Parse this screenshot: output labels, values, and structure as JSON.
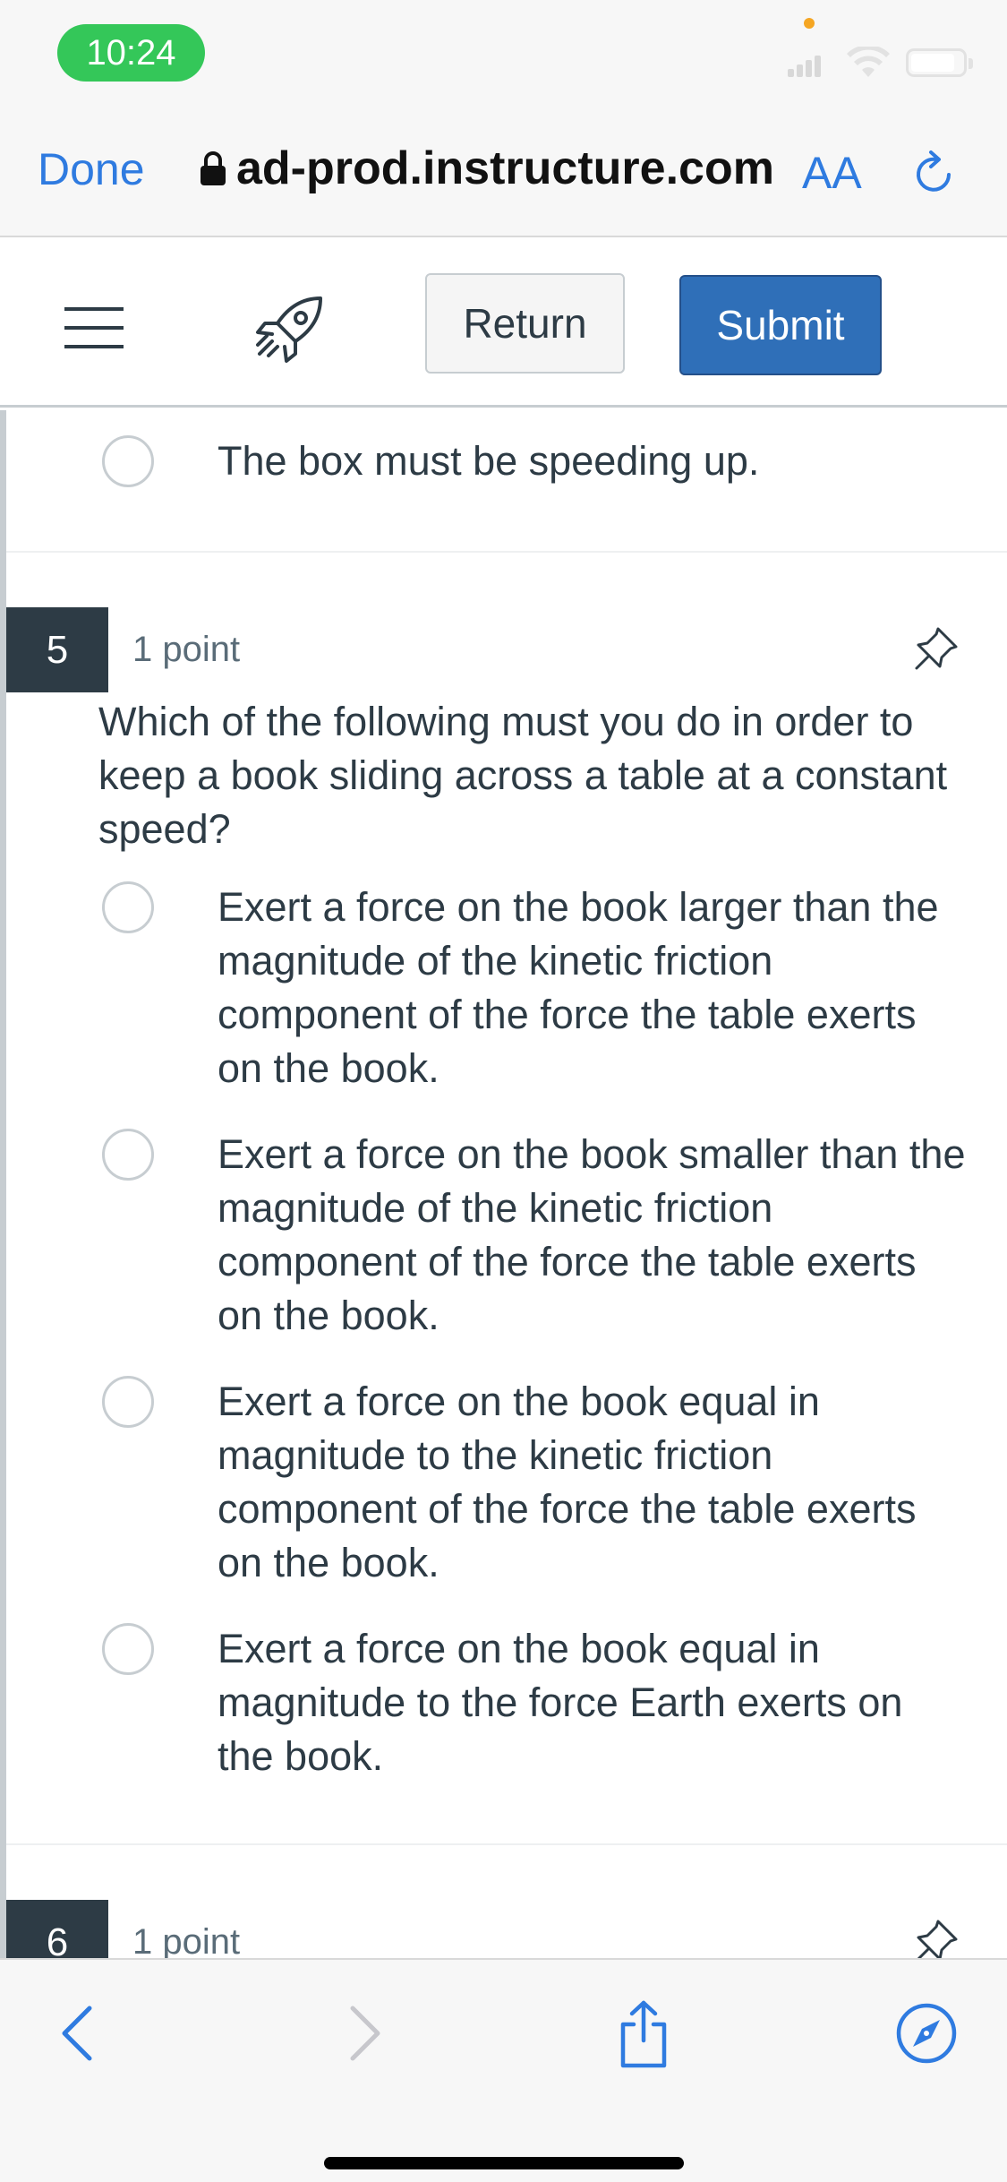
{
  "status_bar": {
    "time": "10:24"
  },
  "browser": {
    "done_label": "Done",
    "url": "ad-prod.instructure.com",
    "aa_label": "AA"
  },
  "header": {
    "return_label": "Return",
    "submit_label": "Submit"
  },
  "prev_answer": {
    "text": "The box must be speeding up."
  },
  "question5": {
    "number": "5",
    "points": "1 point",
    "text": "Which of the following must you do in order to keep a book sliding across a table at a constant speed?",
    "answers": [
      "Exert a force on the book larger than the magnitude of the kinetic friction component of the force the table exerts on the book.",
      "Exert a force on the book smaller than the magnitude of the kinetic friction component of the force the table exerts on the book.",
      "Exert a force on the book equal in magnitude to the kinetic friction component of the force the table exerts on the book.",
      "Exert a force on the book equal in magnitude to the force Earth exerts on the book."
    ]
  },
  "question6": {
    "number": "6",
    "points": "1 point"
  },
  "colors": {
    "accent_blue": "#2f7be0",
    "submit_blue": "#2f6fb8",
    "question_badge": "#2d3b45",
    "time_pill": "#34c759"
  },
  "toolbar_icons": [
    "back-icon",
    "forward-icon",
    "share-icon",
    "compass-icon"
  ]
}
